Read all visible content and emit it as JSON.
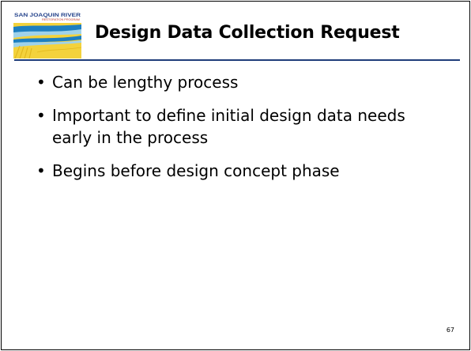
{
  "slide": {
    "logo": {
      "banner_text": "SAN JOAQUIN RIVER",
      "sub_text": "RESTORATION PROGRAM"
    },
    "title": "Design Data Collection Request",
    "bullets": [
      "Can be lengthy process",
      "Important to define initial design data needs early in the process",
      "Begins before design concept phase"
    ],
    "bullet_glyph": "•",
    "page_number": "67"
  },
  "colors": {
    "rule": "#1f3d7a",
    "logo_yellow": "#f3d23c",
    "logo_blue": "#1d7fc1",
    "logo_light_blue": "#9fd2ea",
    "logo_dark_blue": "#22418a",
    "logo_red": "#c0392b"
  }
}
